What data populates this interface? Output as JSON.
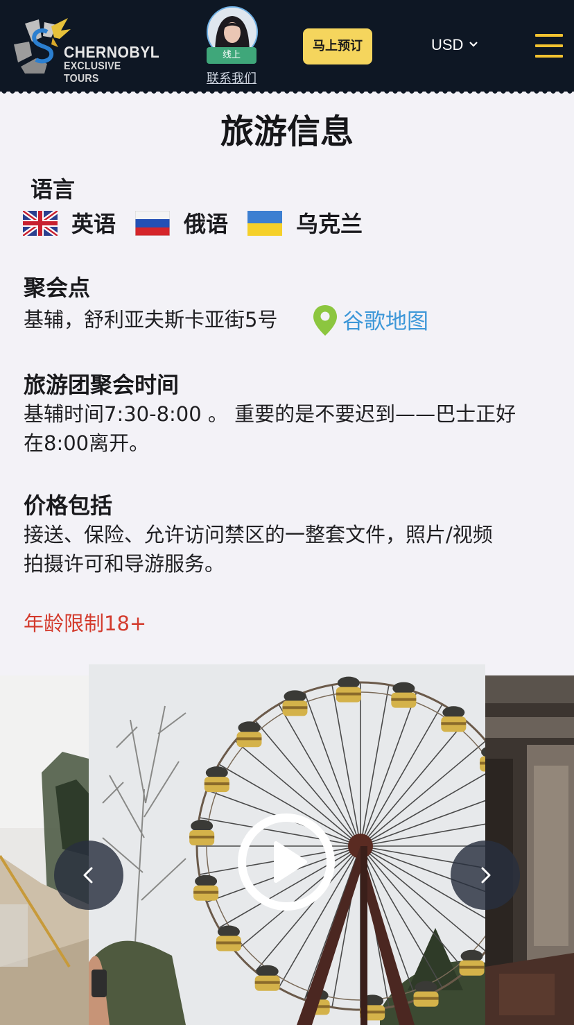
{
  "header": {
    "logo": {
      "line1": "CHERNOBYL",
      "line2": "EXCLUSIVE TOURS"
    },
    "agent": {
      "status": "线上",
      "contact_label": "联系我们"
    },
    "book_label": "马上预订",
    "currency": "USD",
    "colors": {
      "background": "#0e1724",
      "accent": "#f5d55d",
      "online": "#3fa77a"
    }
  },
  "main": {
    "title": "旅游信息",
    "language": {
      "heading": "语言",
      "items": [
        {
          "flag_icon": "uk-flag-icon",
          "label": "英语"
        },
        {
          "flag_icon": "russia-flag-icon",
          "label": "俄语"
        },
        {
          "flag_icon": "ukraine-flag-icon",
          "label": "乌克兰"
        }
      ]
    },
    "meeting_point": {
      "heading": "聚会点",
      "address": "基辅，舒利亚夫斯卡亚街5号",
      "map_link": "谷歌地图"
    },
    "meeting_time": {
      "heading": "旅游团聚会时间",
      "line1": "基辅时间7:30-8:00 。 重要的是不要迟到——巴士正好",
      "line2": "在8:00离开。"
    },
    "price_includes": {
      "heading": "价格包括",
      "line1": "接送、保险、允许访问禁区的一整套文件，照片/视频",
      "line2": "拍摄许可和导游服务。"
    },
    "age_limit": "年龄限制18+",
    "colors": {
      "link": "#3d97d8",
      "warning": "#d33a2c"
    }
  },
  "gallery": {
    "controls": [
      "play-icon",
      "chevron-left-icon",
      "chevron-right-icon"
    ]
  }
}
